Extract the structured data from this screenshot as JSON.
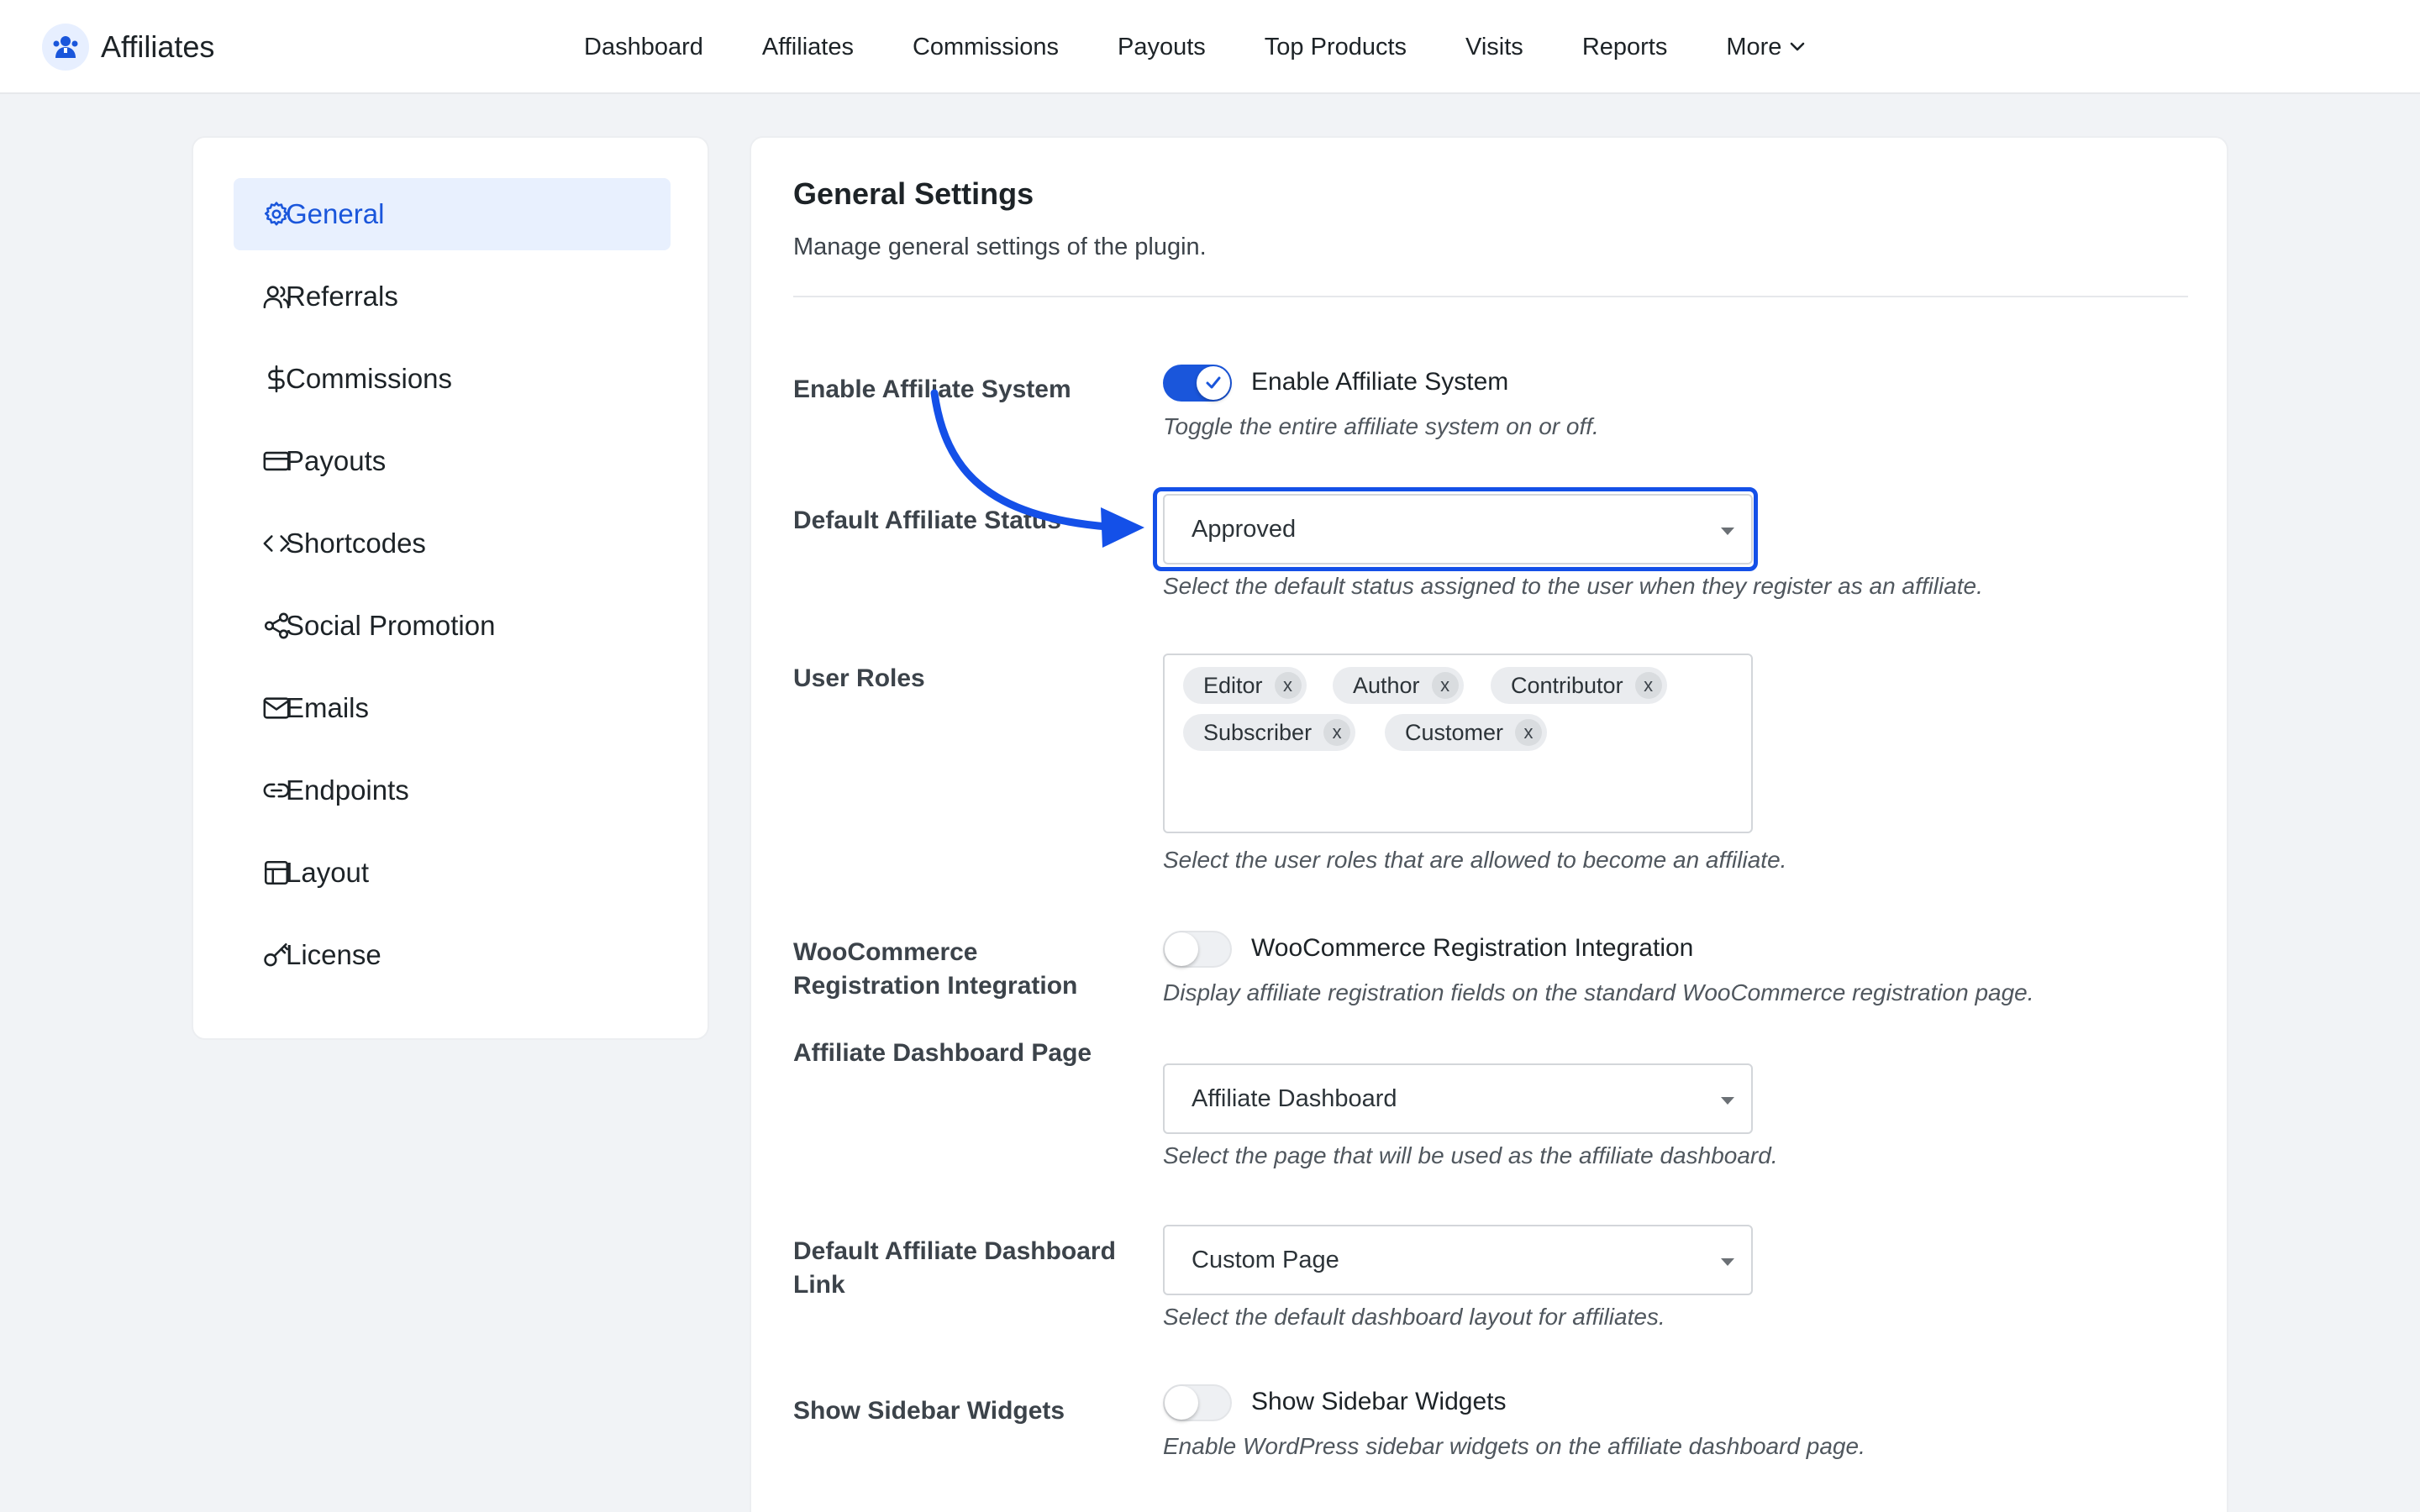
{
  "app": {
    "name": "Affiliates"
  },
  "nav": {
    "items": [
      {
        "label": "Dashboard"
      },
      {
        "label": "Affiliates"
      },
      {
        "label": "Commissions"
      },
      {
        "label": "Payouts"
      },
      {
        "label": "Top Products"
      },
      {
        "label": "Visits"
      },
      {
        "label": "Reports"
      },
      {
        "label": "More"
      }
    ]
  },
  "sidebar": {
    "items": [
      {
        "label": "General",
        "icon": "gear-icon",
        "active": true
      },
      {
        "label": "Referrals",
        "icon": "users-icon"
      },
      {
        "label": "Commissions",
        "icon": "dollar-icon"
      },
      {
        "label": "Payouts",
        "icon": "card-icon"
      },
      {
        "label": "Shortcodes",
        "icon": "code-icon"
      },
      {
        "label": "Social Promotion",
        "icon": "share-icon"
      },
      {
        "label": "Emails",
        "icon": "mail-icon"
      },
      {
        "label": "Endpoints",
        "icon": "link-icon"
      },
      {
        "label": "Layout",
        "icon": "layout-icon"
      },
      {
        "label": "License",
        "icon": "key-icon"
      }
    ]
  },
  "main": {
    "title": "General Settings",
    "subtitle": "Manage general settings of the plugin.",
    "enable_system": {
      "label": "Enable Affiliate System",
      "toggle_text": "Enable Affiliate System",
      "enabled": true,
      "help": "Toggle the entire affiliate system on or off."
    },
    "default_status": {
      "label": "Default Affiliate Status",
      "value": "Approved",
      "help": "Select the default status assigned to the user when they register as an affiliate."
    },
    "user_roles": {
      "label": "User Roles",
      "chips": [
        "Editor",
        "Author",
        "Contributor",
        "Subscriber",
        "Customer"
      ],
      "remove_symbol": "x",
      "help": "Select the user roles that are allowed to become an affiliate."
    },
    "woo_integration": {
      "label": "WooCommerce Registration Integration",
      "toggle_text": "WooCommerce Registration Integration",
      "enabled": false,
      "help": "Display affiliate registration fields on the standard WooCommerce registration page."
    },
    "dashboard_page": {
      "label": "Affiliate Dashboard Page",
      "value": "Affiliate Dashboard",
      "help": "Select the page that will be used as the affiliate dashboard."
    },
    "dashboard_link": {
      "label": "Default Affiliate Dashboard Link",
      "value": "Custom Page",
      "help": "Select the default dashboard layout for affiliates."
    },
    "sidebar_widgets": {
      "label": "Show Sidebar Widgets",
      "toggle_text": "Show Sidebar Widgets",
      "enabled": false,
      "help": "Enable WordPress sidebar widgets on the affiliate dashboard page."
    }
  },
  "colors": {
    "accent": "#1a56db",
    "highlight": "#1450e8",
    "active_bg": "#e8f0fe"
  }
}
